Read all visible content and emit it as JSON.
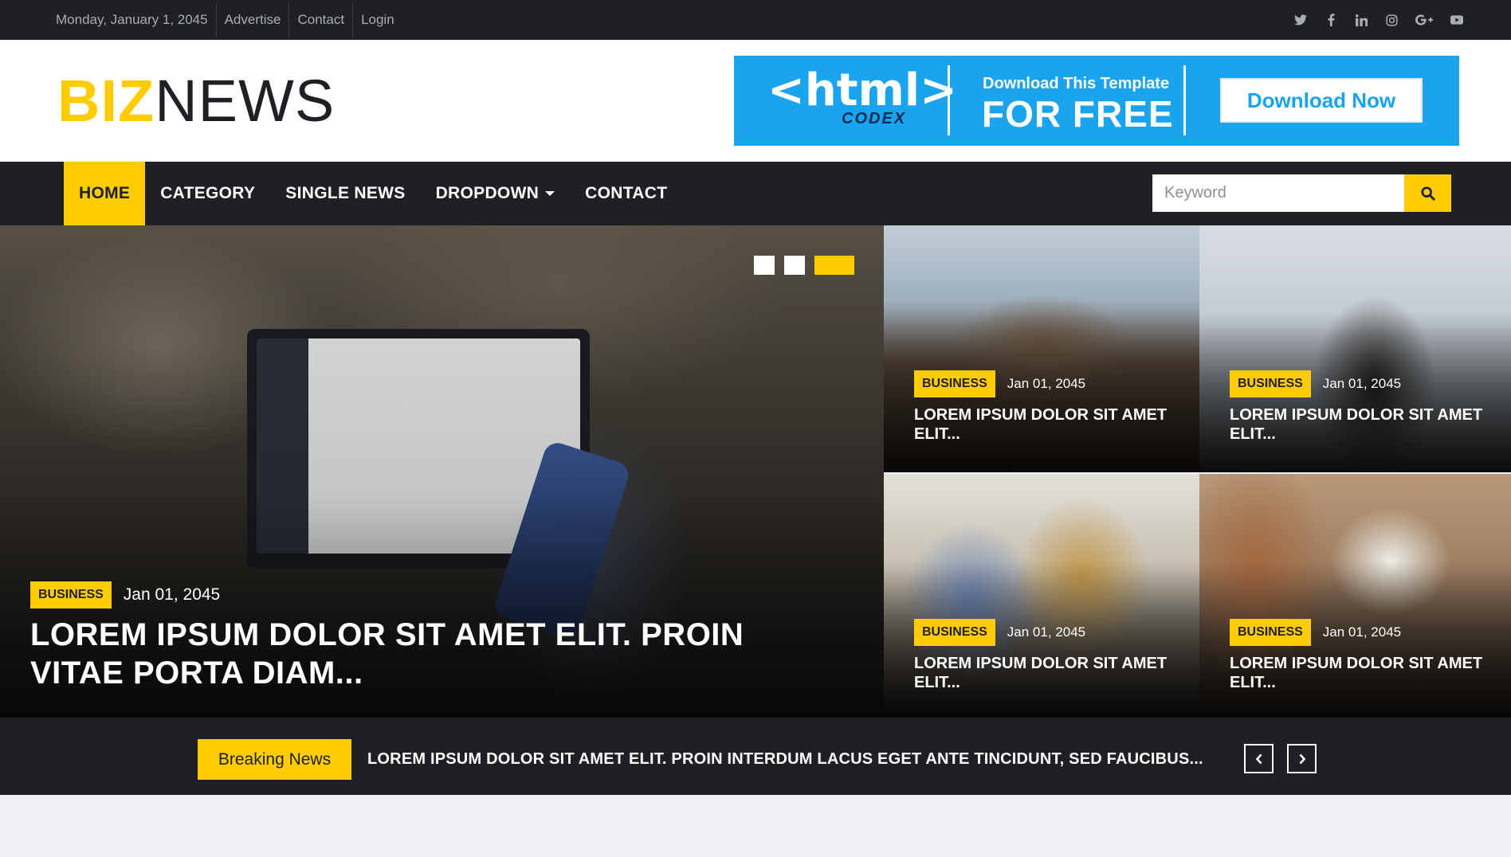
{
  "topbar": {
    "date": "Monday, January 1, 2045",
    "links": [
      "Advertise",
      "Contact",
      "Login"
    ],
    "social": [
      "twitter-icon",
      "facebook-icon",
      "linkedin-icon",
      "instagram-icon",
      "google-plus-icon",
      "youtube-icon"
    ]
  },
  "logo": {
    "part1": "BIZ",
    "part2": "NEWS"
  },
  "banner": {
    "brand": "<html>",
    "sub_brand": "CODEX",
    "small_text": "Download This Template",
    "big_text": "FOR FREE",
    "button": "Download Now"
  },
  "nav": {
    "items": [
      "HOME",
      "CATEGORY",
      "SINGLE NEWS",
      "DROPDOWN",
      "CONTACT"
    ],
    "active": "HOME",
    "search_placeholder": "Keyword"
  },
  "hero": {
    "main": {
      "tag": "BUSINESS",
      "date": "Jan 01, 2045",
      "title": "LOREM IPSUM DOLOR SIT AMET ELIT. PROIN VITAE PORTA DIAM..."
    },
    "cards": [
      {
        "tag": "BUSINESS",
        "date": "Jan 01, 2045",
        "title": "LOREM IPSUM DOLOR SIT AMET ELIT..."
      },
      {
        "tag": "BUSINESS",
        "date": "Jan 01, 2045",
        "title": "LOREM IPSUM DOLOR SIT AMET ELIT..."
      },
      {
        "tag": "BUSINESS",
        "date": "Jan 01, 2045",
        "title": "LOREM IPSUM DOLOR SIT AMET ELIT..."
      },
      {
        "tag": "BUSINESS",
        "date": "Jan 01, 2045",
        "title": "LOREM IPSUM DOLOR SIT AMET ELIT..."
      }
    ],
    "slide_count": 3,
    "active_slide": 3
  },
  "breaking": {
    "label": "Breaking News",
    "text": "LOREM IPSUM DOLOR SIT AMET ELIT. PROIN INTERDUM LACUS EGET ANTE TINCIDUNT, SED FAUCIBUS..."
  },
  "colors": {
    "accent": "#ffcc00",
    "dark": "#1e2024",
    "banner_blue": "#1aa3ef"
  }
}
